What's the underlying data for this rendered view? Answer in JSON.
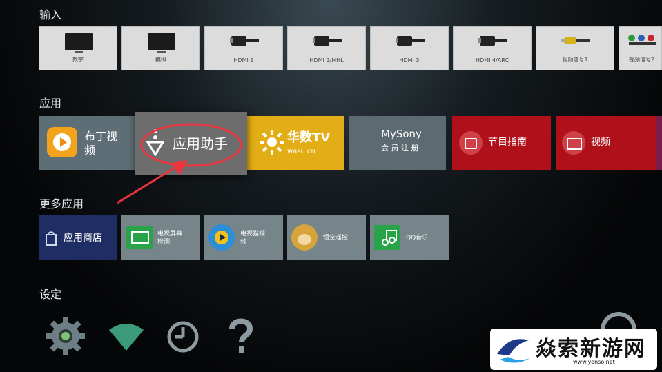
{
  "sections": {
    "input": "输入",
    "apps": "应用",
    "more_apps": "更多应用",
    "settings": "设定"
  },
  "inputs": [
    "数字",
    "模拟",
    "HDMI 1",
    "HDMI 2/MHL",
    "HDMI 3",
    "HDMI 4/ARC",
    "视频信号1",
    "视频信号2"
  ],
  "apps": {
    "pudding": "布丁视\n频",
    "app_assistant": "应用助手",
    "wasu": "华数TV",
    "wasu_sub": "wasu.cn",
    "mysony": "MySony",
    "mysony_sub": "会 员 注 册",
    "guide": "节目指南",
    "video": "视频"
  },
  "more_apps": {
    "app_store": "应用商店",
    "screen_test": "电视屏幕\n检测",
    "tv_cat": "电视猫视\n频",
    "wukong": "悟空遥控",
    "qq_music": "QQ音乐"
  },
  "watermark": {
    "brand": "焱索新游网",
    "url": "www.yenso.net"
  },
  "colors": {
    "apps_tile": "#5e6e76",
    "assistant_tile": "#6d6d6d",
    "wasu_tile": "#e3ad15",
    "mysony_tile": "#5c6a72",
    "red_tile": "#b0101a",
    "app_store_tile": "#1e2d63",
    "annotation": "#e8353e"
  }
}
